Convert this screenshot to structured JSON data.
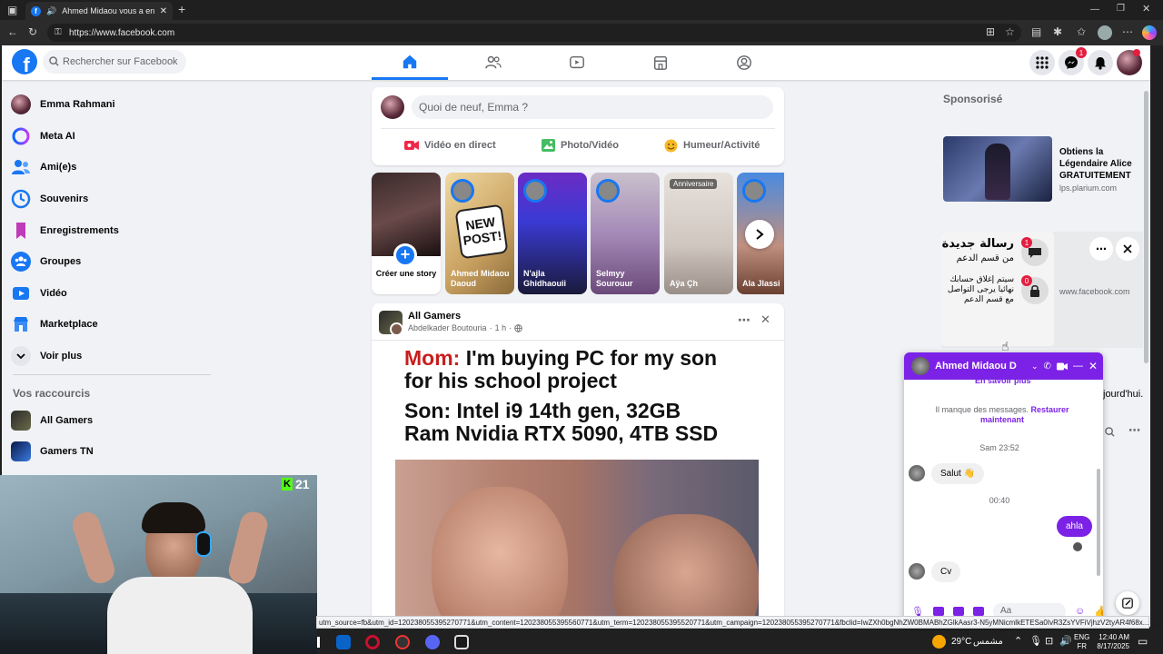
{
  "browser": {
    "tab_title": "Ahmed Midaou vous a envo",
    "url": "https://www.facebook.com"
  },
  "header": {
    "search_placeholder": "Rechercher sur Facebook",
    "messenger_badge": "1"
  },
  "sidebar": {
    "items": [
      {
        "label": "Emma Rahmani",
        "icon": "avatar"
      },
      {
        "label": "Meta AI",
        "icon": "meta-ai-icon"
      },
      {
        "label": "Ami(e)s",
        "icon": "friends-icon"
      },
      {
        "label": "Souvenirs",
        "icon": "memories-icon"
      },
      {
        "label": "Enregistrements",
        "icon": "bookmark-icon"
      },
      {
        "label": "Groupes",
        "icon": "groups-icon"
      },
      {
        "label": "Vidéo",
        "icon": "video-icon"
      },
      {
        "label": "Marketplace",
        "icon": "marketplace-icon"
      },
      {
        "label": "Voir plus",
        "icon": "chevron-down-icon"
      }
    ],
    "shortcuts_title": "Vos raccourcis",
    "shortcuts": [
      {
        "label": "All Gamers"
      },
      {
        "label": "Gamers TN"
      }
    ]
  },
  "composer": {
    "placeholder": "Quoi de neuf, Emma ?",
    "actions": [
      "Vidéo en direct",
      "Photo/Vidéo",
      "Humeur/Activité"
    ]
  },
  "stories": [
    {
      "name": "Créer une story"
    },
    {
      "name": "Ahmed Midaou Daoud"
    },
    {
      "name": "N'ajla Ghidhaouii"
    },
    {
      "name": "Selmyy Sourouur"
    },
    {
      "name": "Aÿa Çh",
      "tag": "Anniversaire"
    },
    {
      "name": "Ala Jlassi"
    }
  ],
  "post": {
    "author": "All Gamers",
    "subline": "Abdelkader Boutouria",
    "time": "1 h",
    "meme_mom": "Mom:",
    "meme_line1_rest": " I'm buying PC for my son",
    "meme_line2": "for his school project",
    "meme_line3": "Son: Intel i9 14th gen, 32GB",
    "meme_line4": "Ram Nvidia RTX 5090, 4TB SSD"
  },
  "right": {
    "sponsored_title": "Sponsorisé",
    "ad_title": "Obtiens la Légendaire Alice GRATUITEMENT",
    "ad_domain": "lps.plarium.com",
    "popup_ar_title": "رسالة جديدة",
    "popup_ar_sub": "من قسم الدعم",
    "popup_ar_body": "سيتم إغلاق حسابك نهائيا يرجى التواصل مع قسم الدعم",
    "popup_badge1": "1",
    "popup_badge2": "0",
    "popup_domain": "www.facebook.com",
    "partial_text": "jourd'hui."
  },
  "chat": {
    "name": "Ahmed Midaou D",
    "learn_more": "En savoir plus",
    "missing_msgs": "Il manque des messages.",
    "restore": "Restaurer maintenant",
    "time1": "Sam 23:52",
    "msg1": "Salut 👋",
    "time2": "00:40",
    "msg2": "ahla",
    "msg3": "Cv",
    "input_placeholder": "Aa"
  },
  "webcam": {
    "kick_count": "21",
    "kick_logo": "K"
  },
  "status_url": "utm_source=fb&utm_id=120238055395270771&utm_content=120238055395560771&utm_term=120238055395520771&utm_campaign=120238055395270771&fbclid=IwZXh0bgNhZW0BMABhZGlkAasr3-N5yMNicmlkETESa0IvR3ZsYVFiVjhzV2tyAR4f68x...",
  "taskbar": {
    "temp": "29°C",
    "weather": "مشمس",
    "lang1": "ENG",
    "lang2": "FR",
    "time": "12:40 AM",
    "date": "8/17/2025"
  },
  "colors": {
    "fb_blue": "#1877f2",
    "chat_purple": "#7b22e6",
    "badge_red": "#e41e3f"
  }
}
